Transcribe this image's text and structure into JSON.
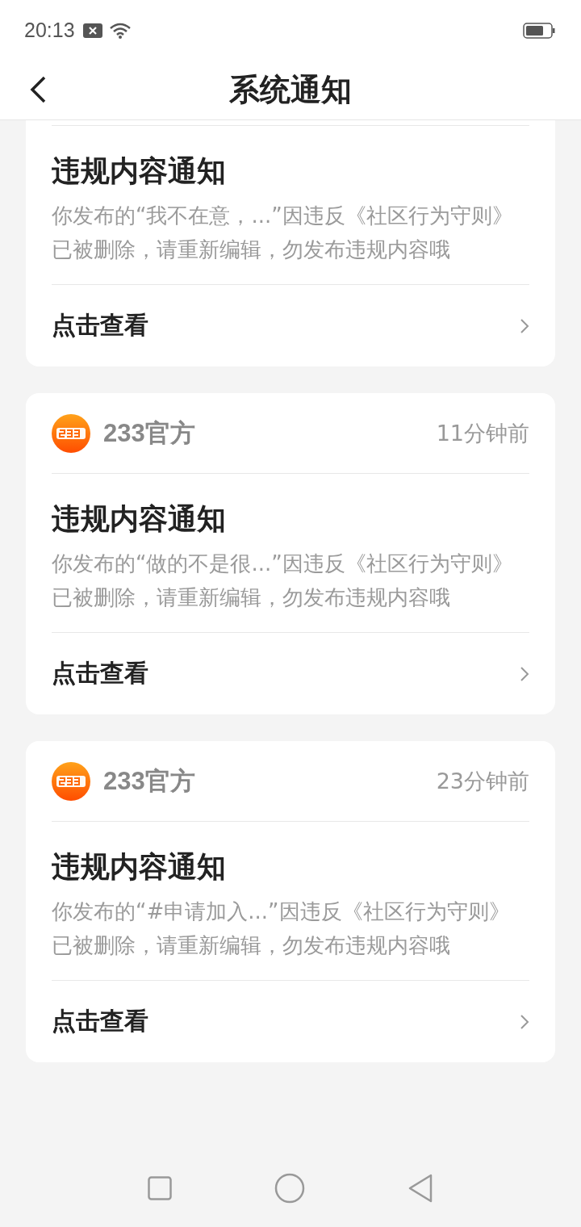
{
  "status_bar": {
    "time": "20:13"
  },
  "header": {
    "title": "系统通知"
  },
  "notifications": [
    {
      "title": "违规内容通知",
      "body": "你发布的“我不在意，...”因违反《社区行为守则》已被删除，请重新编辑，勿发布违规内容哦",
      "action": "点击查看"
    },
    {
      "source": "233官方",
      "time": "11分钟前",
      "title": "违规内容通知",
      "body": "你发布的“做的不是很...”因违反《社区行为守则》已被删除，请重新编辑，勿发布违规内容哦",
      "action": "点击查看"
    },
    {
      "source": "233官方",
      "time": "23分钟前",
      "title": "违规内容通知",
      "body": "你发布的“#申请加入...”因违反《社区行为守则》已被删除，请重新编辑，勿发布违规内容哦",
      "action": "点击查看"
    }
  ]
}
